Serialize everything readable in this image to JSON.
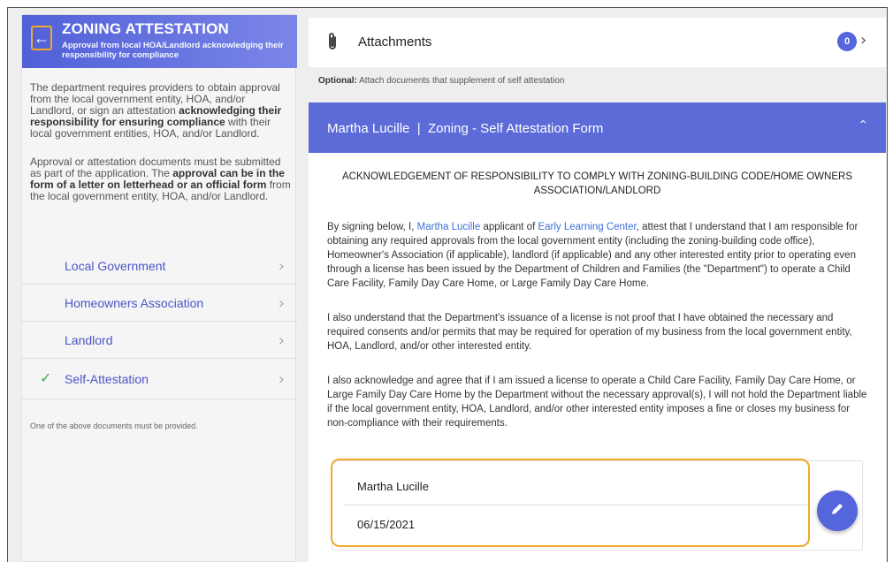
{
  "sidebar": {
    "back_icon": "arrow-left-icon",
    "title": "ZONING ATTESTATION",
    "subtitle": "Approval from local HOA/Landlord acknowledging their responsibility for compliance",
    "desc1_pre": "The department requires providers to obtain approval from the local government entity, HOA, and/or Landlord, or sign an attestation ",
    "desc1_bold": "acknowledging their responsibility for ensuring compliance",
    "desc1_post": " with their local government entities, HOA, and/or Landlord.",
    "desc2_pre": "Approval or attestation documents must be submitted as part of the application. The ",
    "desc2_bold": "approval can be in the form of a letter on letterhead or an official form",
    "desc2_post": " from the local government entity, HOA, and/or Landlord.",
    "items": [
      {
        "label": "Local Government",
        "checked": false
      },
      {
        "label": "Homeowners Association",
        "checked": false
      },
      {
        "label": "Landlord",
        "checked": false
      },
      {
        "label": "Self-Attestation",
        "checked": true
      }
    ],
    "check_glyph": "✓",
    "chevron_glyph": "›",
    "note": "One of the above documents must be provided."
  },
  "attachments": {
    "title": "Attachments",
    "count": "0",
    "optional_label": "Optional:",
    "optional_text": " Attach documents that supplement of self attestation"
  },
  "form": {
    "header_title": "Martha Lucille  |  Zoning - Self Attestation Form",
    "ack_title": "ACKNOWLEDGEMENT OF RESPONSIBILITY TO COMPLY WITH ZONING-BUILDING CODE/HOME OWNERS ASSOCIATION/LANDLORD",
    "p1_pre": "By signing below, I, ",
    "p1_name": "Martha Lucille",
    "p1_mid": " applicant of ",
    "p1_org": "Early Learning Center",
    "p1_post": ", attest that I understand that I am responsible for obtaining any required approvals from the local government entity (including the zoning-building code office), Homeowner's Association (if applicable), landlord (if applicable) and any other interested entity prior to operating even through a license has been issued by the Department of Children and Families (the \"Department\") to operate a Child Care Facility, Family Day Care Home, or Large Family Day Care Home.",
    "p2": "I also understand that the Department's issuance of a license is not proof that I have obtained the necessary and required consents and/or permits that may be required for operation of my business from the local government entity, HOA, Landlord, and/or other interested entity.",
    "p3": "I also acknowledge and agree that if I am issued a license to operate a Child Care Facility, Family Day Care Home, or Large Family Day Care Home by the Department without the necessary approval(s), I will not hold the Department liable if the local government entity, HOA, Landlord, and/or other interested entity imposes a fine or closes my business for non-compliance with their requirements.",
    "signature_name": "Martha Lucille",
    "signature_date": "06/15/2021"
  },
  "colors": {
    "accent": "#5c6bd8",
    "highlight": "#f0a92a",
    "check": "#3cb043",
    "link": "#3d6fd6"
  }
}
